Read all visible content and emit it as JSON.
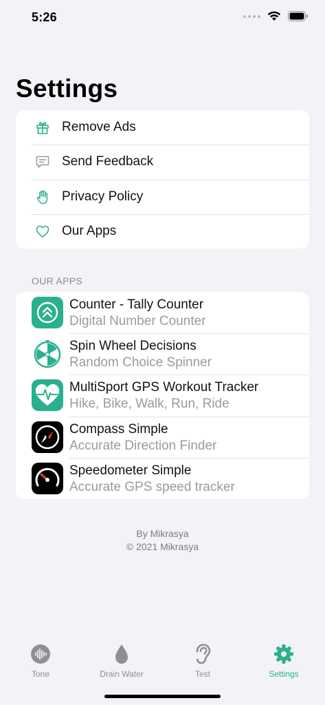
{
  "status_bar": {
    "time": "5:26"
  },
  "page": {
    "title": "Settings"
  },
  "menu": {
    "items": [
      {
        "label": "Remove Ads",
        "icon": "gift-icon"
      },
      {
        "label": "Send Feedback",
        "icon": "message-icon"
      },
      {
        "label": "Privacy Policy",
        "icon": "hand-icon"
      },
      {
        "label": "Our Apps",
        "icon": "heart-icon"
      }
    ]
  },
  "apps_section": {
    "header": "OUR APPS",
    "apps": [
      {
        "title": "Counter - Tally Counter",
        "subtitle": "Digital Number Counter",
        "icon": "counter-app-icon"
      },
      {
        "title": "Spin Wheel Decisions",
        "subtitle": "Random Choice Spinner",
        "icon": "spin-wheel-app-icon"
      },
      {
        "title": "MultiSport GPS Workout Tracker",
        "subtitle": "Hike, Bike, Walk, Run, Ride",
        "icon": "heart-pulse-app-icon"
      },
      {
        "title": "Compass Simple",
        "subtitle": "Accurate Direction Finder",
        "icon": "compass-app-icon"
      },
      {
        "title": "Speedometer Simple",
        "subtitle": "Accurate GPS speed tracker",
        "icon": "speedometer-app-icon"
      }
    ]
  },
  "footer": {
    "line1": "By Mikrasya",
    "line2": "© 2021 Mikrasya"
  },
  "tabbar": {
    "tabs": [
      {
        "label": "Tone",
        "icon": "waveform-icon"
      },
      {
        "label": "Drain Water",
        "icon": "drop-icon"
      },
      {
        "label": "Test",
        "icon": "ear-icon"
      },
      {
        "label": "Settings",
        "icon": "gear-icon"
      }
    ],
    "active": "Settings"
  },
  "colors": {
    "accent": "#2ab08f",
    "background": "#f2f2f7",
    "secondary_text": "#9a9aa0"
  }
}
